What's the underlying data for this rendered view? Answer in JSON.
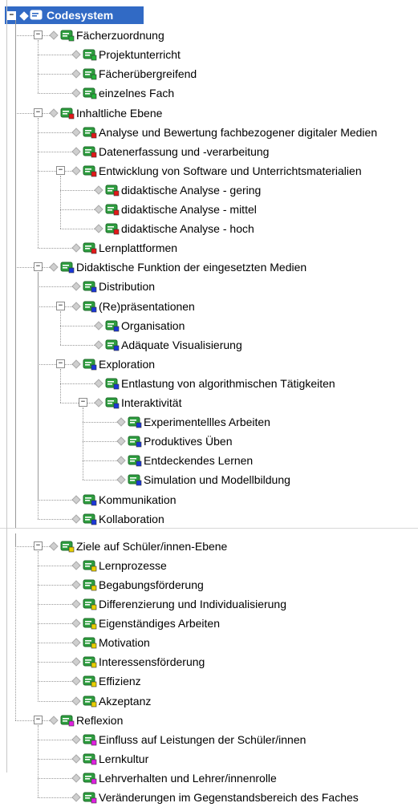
{
  "colors": {
    "selection": "#316ac5",
    "green": "#24b43a",
    "red": "#e21919",
    "blue": "#1a37d8",
    "magenta": "#e020e0",
    "yellow": "#e8d000",
    "icon_green": "#2e9e3f"
  },
  "tree": {
    "root_label": "Codesystem",
    "items": [
      {
        "label": "Fächerzuordnung",
        "depth": 1,
        "toggle": "−",
        "marker": "green"
      },
      {
        "label": "Projektunterricht",
        "depth": 2,
        "marker": "green"
      },
      {
        "label": "Fächerübergreifend",
        "depth": 2,
        "marker": "green"
      },
      {
        "label": "einzelnes Fach",
        "depth": 2,
        "marker": "green"
      },
      {
        "label": "Inhaltliche Ebene",
        "depth": 1,
        "toggle": "−",
        "marker": "red"
      },
      {
        "label": "Analyse und Bewertung fachbezogener digitaler Medien",
        "depth": 2,
        "marker": "red"
      },
      {
        "label": "Datenerfassung und -verarbeitung",
        "depth": 2,
        "marker": "red"
      },
      {
        "label": "Entwicklung von Software und Unterrichtsmaterialien",
        "depth": 2,
        "toggle": "−",
        "marker": "red"
      },
      {
        "label": "didaktische Analyse - gering",
        "depth": 3,
        "marker": "red"
      },
      {
        "label": "didaktische Analyse - mittel",
        "depth": 3,
        "marker": "red"
      },
      {
        "label": "didaktische Analyse - hoch",
        "depth": 3,
        "marker": "red"
      },
      {
        "label": "Lernplattformen",
        "depth": 2,
        "marker": "red"
      },
      {
        "label": "Didaktische Funktion der eingesetzten Medien",
        "depth": 1,
        "toggle": "−",
        "marker": "blue"
      },
      {
        "label": "Distribution",
        "depth": 2,
        "marker": "blue"
      },
      {
        "label": "(Re)präsentationen",
        "depth": 2,
        "toggle": "−",
        "marker": "blue"
      },
      {
        "label": "Organisation",
        "depth": 3,
        "marker": "blue"
      },
      {
        "label": "Adäquate Visualisierung",
        "depth": 3,
        "marker": "blue"
      },
      {
        "label": "Exploration",
        "depth": 2,
        "toggle": "−",
        "marker": "blue"
      },
      {
        "label": "Entlastung von algorithmischen Tätigkeiten",
        "depth": 3,
        "marker": "blue"
      },
      {
        "label": "Interaktivität",
        "depth": 3,
        "toggle": "−",
        "marker": "blue"
      },
      {
        "label": "Experimentellles Arbeiten",
        "depth": 4,
        "marker": "blue"
      },
      {
        "label": "Produktives Üben",
        "depth": 4,
        "marker": "blue"
      },
      {
        "label": "Entdeckendes Lernen",
        "depth": 4,
        "marker": "blue"
      },
      {
        "label": "Simulation und Modellbildung",
        "depth": 4,
        "marker": "blue"
      },
      {
        "label": "Kommunikation",
        "depth": 2,
        "marker": "blue"
      },
      {
        "label": "Kollaboration",
        "depth": 2,
        "marker": "blue"
      },
      {
        "label": "Ziele auf Schüler/innen-Ebene",
        "depth": 1,
        "toggle": "−",
        "marker": "yellow"
      },
      {
        "label": "Lernprozesse",
        "depth": 2,
        "marker": "yellow"
      },
      {
        "label": "Begabungsförderung",
        "depth": 2,
        "marker": "yellow"
      },
      {
        "label": "Differenzierung und Individualisierung",
        "depth": 2,
        "marker": "yellow"
      },
      {
        "label": "Eigenständiges Arbeiten",
        "depth": 2,
        "marker": "yellow"
      },
      {
        "label": "Motivation",
        "depth": 2,
        "marker": "yellow"
      },
      {
        "label": "Interessensförderung",
        "depth": 2,
        "marker": "yellow"
      },
      {
        "label": "Effizienz",
        "depth": 2,
        "marker": "yellow"
      },
      {
        "label": "Akzeptanz",
        "depth": 2,
        "marker": "yellow"
      },
      {
        "label": "Reflexion",
        "depth": 1,
        "toggle": "−",
        "marker": "magenta"
      },
      {
        "label": "Einfluss auf Leistungen der Schüler/innen",
        "depth": 2,
        "marker": "magenta"
      },
      {
        "label": "Lernkultur",
        "depth": 2,
        "marker": "magenta"
      },
      {
        "label": "Lehrverhalten und Lehrer/innenrolle",
        "depth": 2,
        "marker": "magenta"
      },
      {
        "label": "Veränderungen im Gegenstandsbereich des Faches",
        "depth": 2,
        "marker": "magenta"
      }
    ]
  }
}
